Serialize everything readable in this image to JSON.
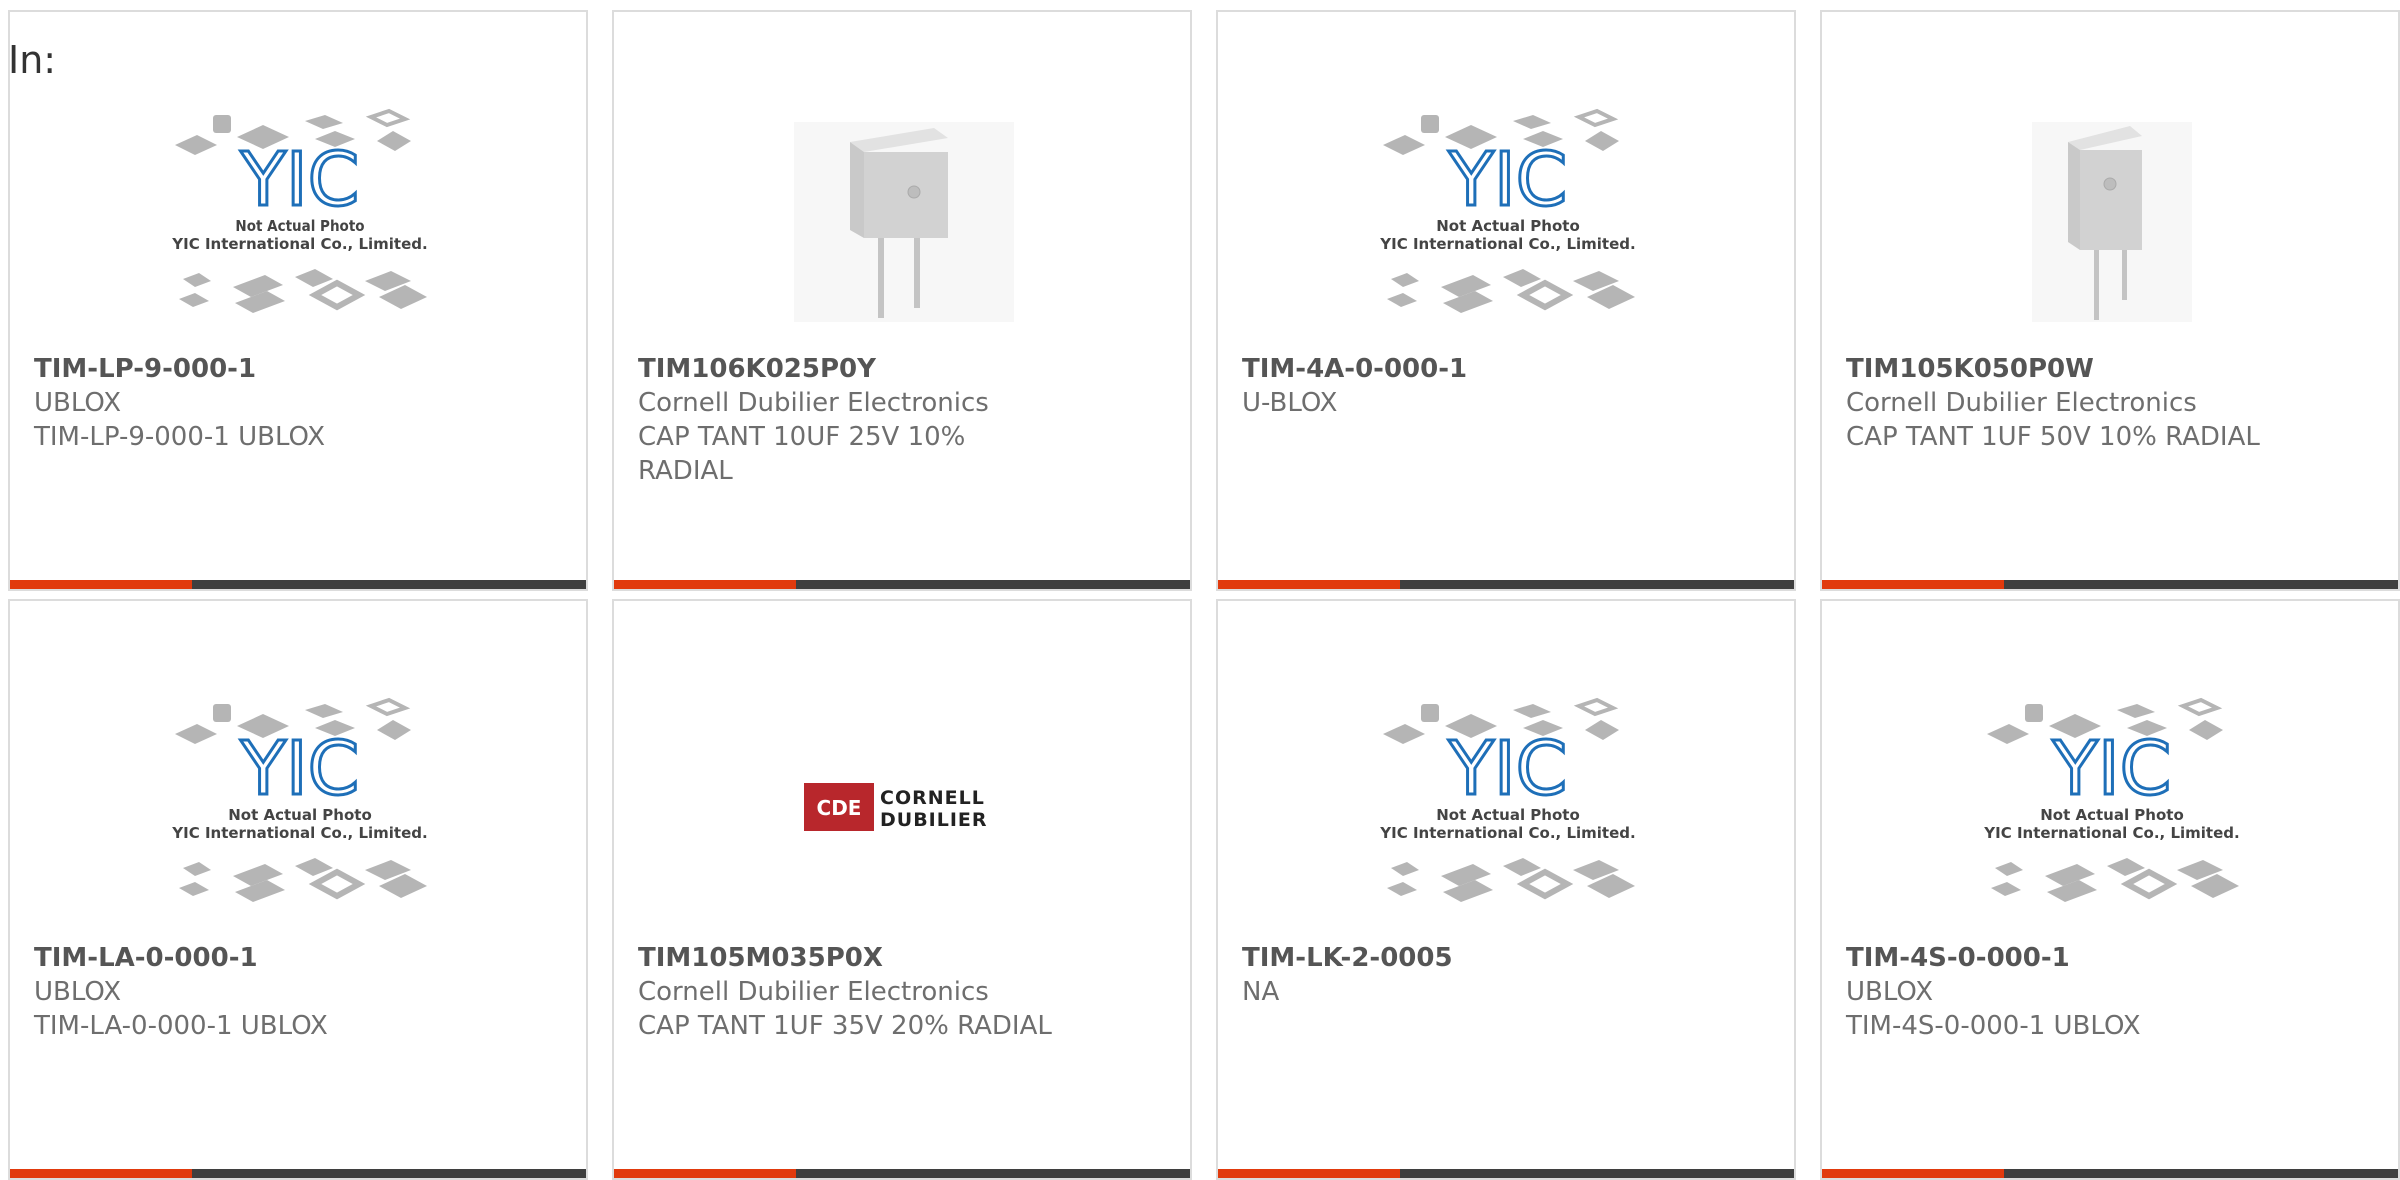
{
  "page": {
    "filter_label": "In:"
  },
  "colors": {
    "accent": "#e13a0d",
    "bar": "#3f3f3f",
    "border": "#dcdcdc",
    "yic_blue": "#1e6fb8",
    "cde_red": "#b8272c"
  },
  "yic_placeholder": {
    "line1": "Not Actual Photo",
    "line2": "YIC International Co., Limited.",
    "logo": "YIC"
  },
  "cde_logo": {
    "badge": "CDE",
    "line1": "CORNELL",
    "line2": "DUBILIER"
  },
  "products": [
    {
      "part": "TIM-LP-9-000-1",
      "manufacturer": "UBLOX",
      "description": "TIM-LP-9-000-1 UBLOX",
      "image": "yic-placeholder"
    },
    {
      "part": "TIM106K025P0Y",
      "manufacturer": "Cornell Dubilier Electronics",
      "description": "CAP TANT 10UF 25V 10% RADIAL",
      "image": "radial-capacitor-wide"
    },
    {
      "part": "TIM-4A-0-000-1",
      "manufacturer": "U-BLOX",
      "description": "",
      "image": "yic-placeholder"
    },
    {
      "part": "TIM105K050P0W",
      "manufacturer": "Cornell Dubilier Electronics",
      "description": "CAP TANT 1UF 50V 10% RADIAL",
      "image": "radial-capacitor-narrow"
    },
    {
      "part": "TIM-LA-0-000-1",
      "manufacturer": "UBLOX",
      "description": "TIM-LA-0-000-1 UBLOX",
      "image": "yic-placeholder"
    },
    {
      "part": "TIM105M035P0X",
      "manufacturer": "Cornell Dubilier Electronics",
      "description": "CAP TANT 1UF 35V 20% RADIAL",
      "image": "cde-logo"
    },
    {
      "part": "TIM-LK-2-0005",
      "manufacturer": "NA",
      "description": "",
      "image": "yic-placeholder"
    },
    {
      "part": "TIM-4S-0-000-1",
      "manufacturer": "UBLOX",
      "description": "TIM-4S-0-000-1 UBLOX",
      "image": "yic-placeholder"
    }
  ]
}
